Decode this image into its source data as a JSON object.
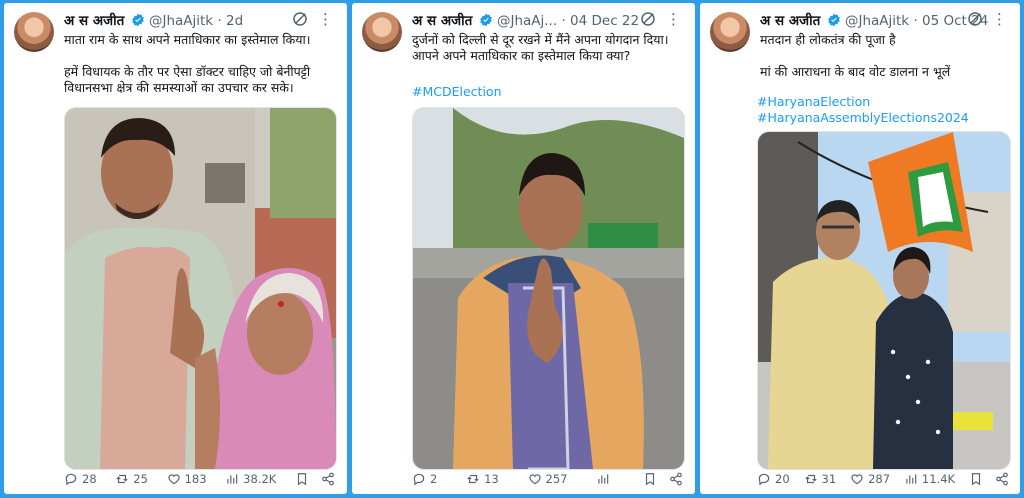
{
  "tweets": [
    {
      "author": "अ स अजीत",
      "handle": "@JhaAjitk",
      "dot": "·",
      "date": "2d",
      "text": "माता राम के साथ अपने मताधिकार का इस्तेमाल किया।\n\nहमें विधायक के तौर पर ऐसा डॉक्टर चाहिए जो बेनीपट्टी विधानसभा क्षेत्र की समस्याओं का उपचार कर सके।",
      "hashtags": [],
      "photo_alt": "Man and elderly woman showing inked fingers after voting",
      "replies": "28",
      "reposts": "25",
      "likes": "183",
      "views": "38.2K"
    },
    {
      "author": "अ स अजीत",
      "handle": "@JhaAj...",
      "dot": "·",
      "date": "04 Dec 22",
      "text": "दुर्जनों को दिल्ली से दूर रखने में मैंने अपना योगदान दिया।\nआपने अपने मताधिकार का इस्तेमाल किया क्या?",
      "hashtags": [
        "#MCDElection"
      ],
      "photo_alt": "Man in orange jacket and checked scarf showing inked finger on street",
      "replies": "2",
      "reposts": "13",
      "likes": "257",
      "views": ""
    },
    {
      "author": "अ स अजीत",
      "handle": "@JhaAjitk",
      "dot": "·",
      "date": "05 Oct 24",
      "text": "मतदान ही लोकतंत्र की पूजा है\n\nमां की आराधना के बाद वोट डालना न भूलें",
      "hashtags": [
        "#HaryanaElection",
        "#HaryanaAssemblyElections2024"
      ],
      "photo_alt": "Man and woman showing inked fingers next to a party flag",
      "replies": "20",
      "reposts": "31",
      "likes": "287",
      "views": "11.4K"
    }
  ],
  "colors": {
    "background": "#2f9de8",
    "link": "#1d9bf0",
    "verified": "#1d9bf0",
    "muted": "#536471"
  }
}
